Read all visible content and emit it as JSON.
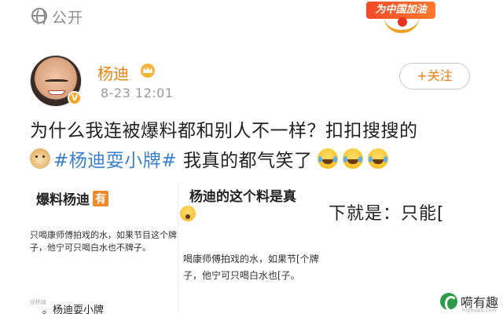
{
  "header": {
    "visibility_icon": "globe-icon",
    "visibility_label": "公开",
    "badge_text": "为中国加油"
  },
  "author": {
    "name": "杨迪",
    "verified_icon": "verified-badge-icon",
    "crown_icon": "crown-icon",
    "timestamp": "8-23 12:01",
    "follow_label": "+关注"
  },
  "post": {
    "line1": "为什么我连被爆料都和别人不一样？扣扣搜搜的",
    "hashtag": "#杨迪耍小牌#",
    "tail": "我真的都气笑了",
    "emojis": [
      "doge-emoji",
      "laugh-cry-emoji",
      "laugh-cry-emoji",
      "laugh-cry-emoji"
    ]
  },
  "screenshots": [
    {
      "title": "爆料杨迪",
      "tag": "有",
      "body": "只喝康师傅拍戏的水，如果节目这个牌子，他宁可只喝白水也不牌子。",
      "footer_small": "@杨迪",
      "footer": "。杨迪耍小牌"
    },
    {
      "title": "杨迪的这个料是真",
      "body": "喝康师傅拍戏的水，如果节[个牌子，他宁可只喝白水也[子。"
    },
    {
      "text": "下就是：只能["
    }
  ],
  "watermark": {
    "name": "嗬有趣",
    "sub": "hiyouqu.com"
  },
  "colors": {
    "username": "#e8800f",
    "hashtag": "#3b7fd0",
    "follow_text": "#e8800f",
    "timestamp": "#9a9a9a"
  }
}
